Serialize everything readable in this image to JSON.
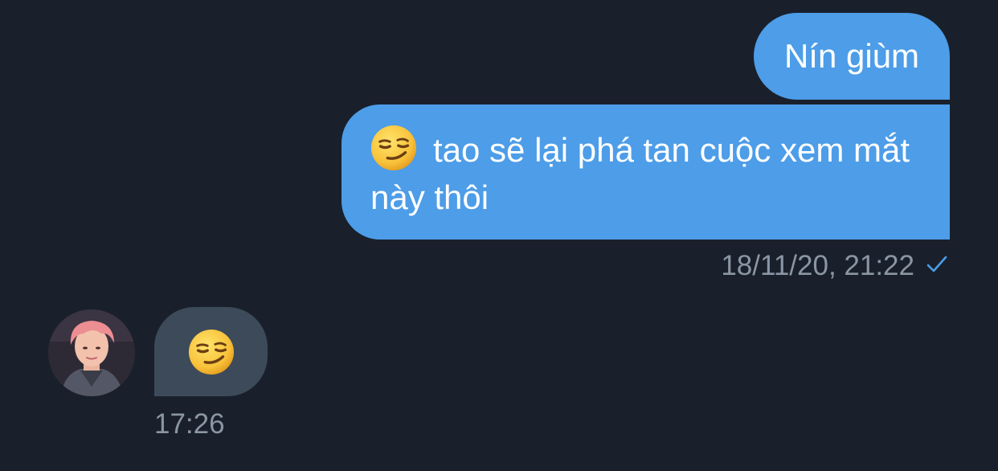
{
  "conversation": {
    "messages": [
      {
        "direction": "outgoing",
        "text": "Nín giùm"
      },
      {
        "direction": "outgoing",
        "emoji": "smirking-face",
        "text": "tao sẽ lại phá tan cuộc xem mắt này thôi",
        "timestamp": "18/11/20, 21:22",
        "status": "sent"
      },
      {
        "direction": "incoming",
        "emoji": "smirking-face",
        "timestamp": "17:26"
      }
    ]
  },
  "colors": {
    "background": "#19202b",
    "outgoing_bubble": "#4d9de8",
    "incoming_bubble": "#3d4a59",
    "meta_text": "#8b96a4"
  },
  "icons": {
    "check": "checkmark-icon",
    "emoji": "smirking-face-emoji"
  }
}
